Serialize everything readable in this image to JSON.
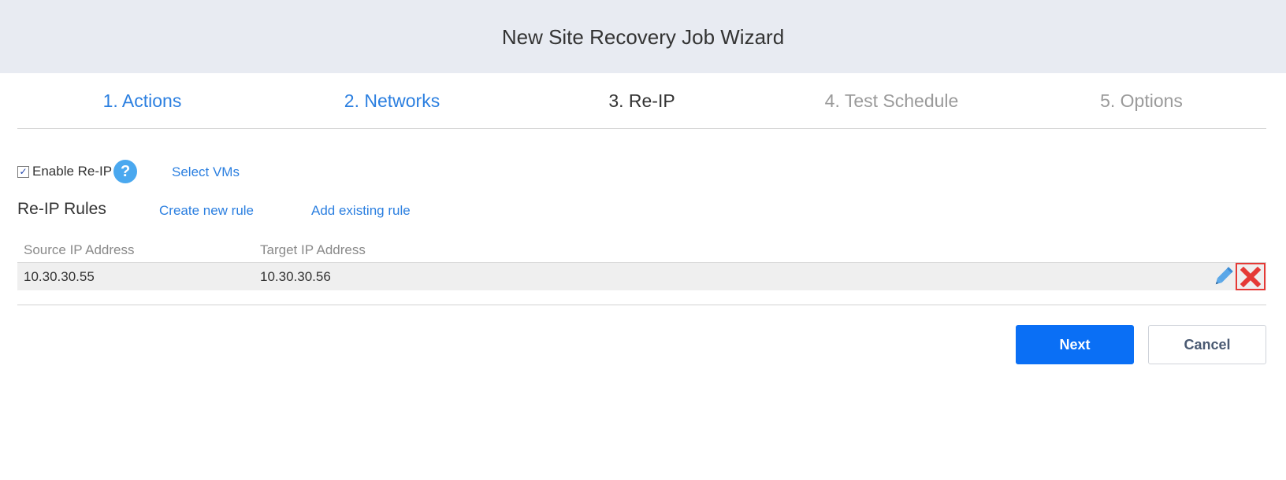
{
  "header": {
    "title": "New Site Recovery Job Wizard"
  },
  "steps": [
    {
      "label": "1. Actions",
      "state": "done"
    },
    {
      "label": "2. Networks",
      "state": "done"
    },
    {
      "label": "3. Re-IP",
      "state": "current"
    },
    {
      "label": "4. Test Schedule",
      "state": "future"
    },
    {
      "label": "5. Options",
      "state": "future"
    }
  ],
  "reip": {
    "enable_label": "Enable Re-IP",
    "enable_checked": true,
    "help_icon": "question-circle-icon",
    "select_vms": "Select VMs"
  },
  "rules": {
    "title": "Re-IP Rules",
    "create_new": "Create new rule",
    "add_existing": "Add existing rule",
    "columns": [
      "Source IP Address",
      "Target IP Address"
    ],
    "rows": [
      {
        "source": "10.30.30.55",
        "target": "10.30.30.56"
      }
    ],
    "row_actions": [
      "pencil-edit-icon",
      "close-x-icon"
    ]
  },
  "buttons": {
    "next": "Next",
    "cancel": "Cancel"
  },
  "colors": {
    "accent": "#2b7fe0",
    "primary_button": "#0a6ff5",
    "header_bg": "#e8ebf2",
    "delete_red": "#e53935",
    "help_blue": "#4aa8ef",
    "edit_blue": "#5aa7e8"
  }
}
